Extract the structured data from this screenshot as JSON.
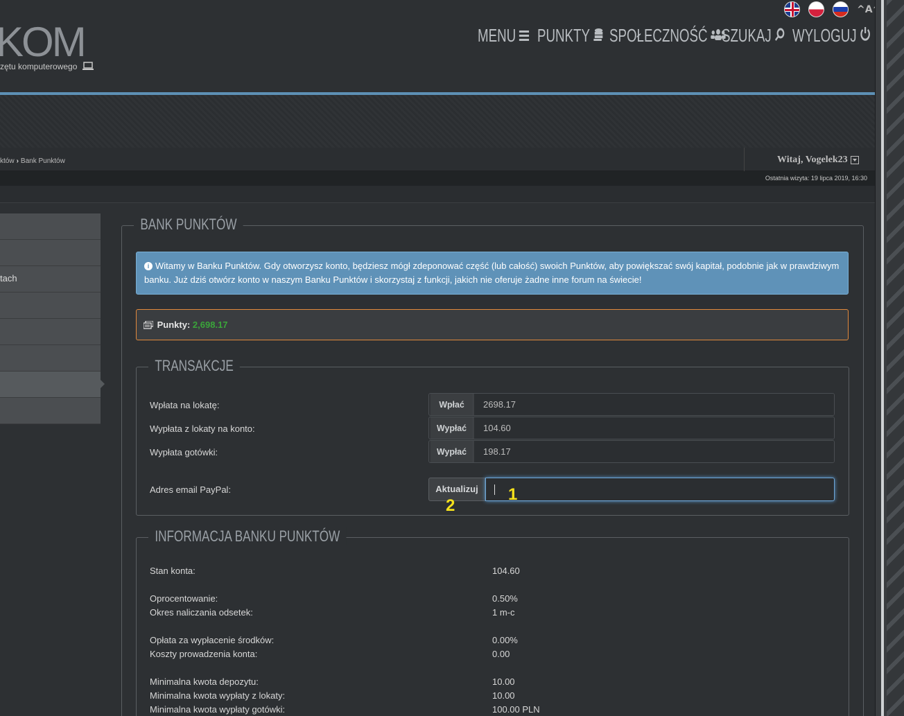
{
  "header": {
    "logo_text": "KOM",
    "tagline": "zętu komputerowego",
    "font_toggle": "^A^",
    "nav": [
      {
        "label": "MENU",
        "icon": "menu-icon"
      },
      {
        "label": "PUNKTY",
        "icon": "coins-icon"
      },
      {
        "label": "SPOŁECZNOŚĆ",
        "icon": "users-icon"
      },
      {
        "label": "SZUKAJ",
        "icon": "search-icon"
      },
      {
        "label": "WYLOGUJ",
        "icon": "power-icon"
      }
    ],
    "languages": [
      "en",
      "pl",
      "ru"
    ]
  },
  "breadcrumb": {
    "parent": "któw",
    "current": "Bank Punktów"
  },
  "user": {
    "welcome": "Witaj, Vogelek23",
    "last_visit": "Ostatnia wizyta: 19 lipca 2019, 16:30"
  },
  "sidebar": {
    "items": [
      "",
      "",
      "tach",
      "",
      "",
      "",
      "",
      ""
    ],
    "active_index": 6
  },
  "bank": {
    "title": "BANK PUNKTÓW",
    "info": "Witamy w Banku Punktów. Gdy otworzysz konto, będziesz mógł zdeponować część (lub całość) swoich Punktów, aby powiększać swój kapitał, podobnie jak w prawdziwym banku. Już dziś otwórz konto w naszym Banku Punktów i skorzystaj z funkcji, jakich nie oferuje żadne inne forum na świecie!",
    "points_label": "Punkty:",
    "points_value": "2,698.17"
  },
  "transactions": {
    "title": "TRANSAKCJE",
    "rows": [
      {
        "label": "Wpłata na lokatę:",
        "button": "Wpłać",
        "value": "2698.17"
      },
      {
        "label": "Wypłata z lokaty na konto:",
        "button": "Wypłać",
        "value": "104.60"
      },
      {
        "label": "Wypłata gotówki:",
        "button": "Wypłać",
        "value": "198.17"
      }
    ],
    "paypal_label": "Adres email PayPal:",
    "paypal_button": "Aktualizuj",
    "paypal_value": "",
    "annotation_input": "1",
    "annotation_button": "2",
    "annotation_color": "#f5e11c"
  },
  "bank_info": {
    "title": "INFORMACJA BANKU PUNKTÓW",
    "stats": [
      {
        "label": "Stan konta:",
        "value": "104.60"
      },
      {
        "label": "Oprocentowanie:",
        "value": "0.50%"
      },
      {
        "label": "Okres naliczania odsetek:",
        "value": "1 m-c"
      },
      {
        "label": "Opłata za wypłacenie środków:",
        "value": "0.00%"
      },
      {
        "label": "Koszty prowadzenia konta:",
        "value": "0.00"
      },
      {
        "label": "Minimalna kwota depozytu:",
        "value": "10.00"
      },
      {
        "label": "Minimalna kwota wypłaty z lokaty:",
        "value": "10.00"
      },
      {
        "label": "Minimalna kwota wypłaty gotówki:",
        "value": "100.00 PLN"
      }
    ]
  },
  "colors": {
    "accent": "#5d90b5",
    "info_bg": "#5f92b8",
    "points_border": "#e28a3c",
    "points_value": "#3aa53a"
  }
}
